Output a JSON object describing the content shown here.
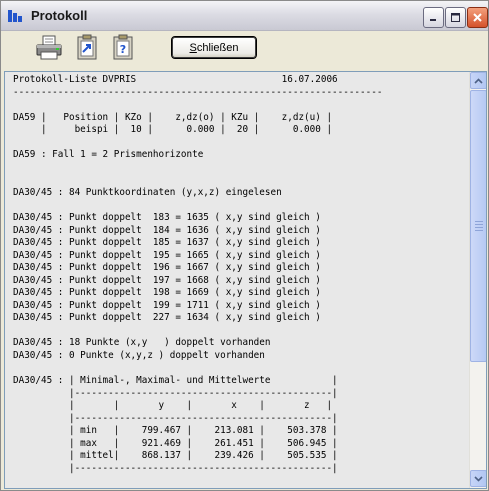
{
  "window": {
    "title": "Protokoll"
  },
  "toolbar": {
    "close_label_underlined": "S",
    "close_label_rest": "chließen",
    "icons": [
      "printer-icon",
      "clipboard-export-icon",
      "help-document-icon"
    ]
  },
  "protocol": {
    "lines": [
      "Protokoll-Liste DVPRIS                          16.07.2006",
      "------------------------------------------------------------------",
      "",
      "DA59 |   Position | KZo |    z,dz(o) | KZu |    z,dz(u) |",
      "     |     beispi |  10 |      0.000 |  20 |      0.000 |",
      "",
      "DA59 : Fall 1 = 2 Prismenhorizonte",
      "",
      "",
      "DA30/45 : 84 Punktkoordinaten (y,x,z) eingelesen",
      "",
      "DA30/45 : Punkt doppelt  183 = 1635 ( x,y sind gleich )",
      "DA30/45 : Punkt doppelt  184 = 1636 ( x,y sind gleich )",
      "DA30/45 : Punkt doppelt  185 = 1637 ( x,y sind gleich )",
      "DA30/45 : Punkt doppelt  195 = 1665 ( x,y sind gleich )",
      "DA30/45 : Punkt doppelt  196 = 1667 ( x,y sind gleich )",
      "DA30/45 : Punkt doppelt  197 = 1668 ( x,y sind gleich )",
      "DA30/45 : Punkt doppelt  198 = 1669 ( x,y sind gleich )",
      "DA30/45 : Punkt doppelt  199 = 1711 ( x,y sind gleich )",
      "DA30/45 : Punkt doppelt  227 = 1634 ( x,y sind gleich )",
      "",
      "DA30/45 : 18 Punkte (x,y   ) doppelt vorhanden",
      "DA30/45 : 0 Punkte (x,y,z ) doppelt vorhanden",
      "",
      "DA30/45 : | Minimal-, Maximal- und Mittelwerte           |",
      "          |----------------------------------------------|",
      "          |       |       y    |       x    |       z   |",
      "          |----------------------------------------------|",
      "          | min   |    799.467 |    213.081 |    503.378 |",
      "          | max   |    921.469 |    261.451 |    506.945 |",
      "          | mittel|    868.137 |    239.426 |    505.535 |",
      "          |----------------------------------------------|"
    ]
  },
  "colors": {
    "window_bg": "#ece9d8",
    "text_bg": "#e8e8e8",
    "scrollbar_accent": "#b6c9f3"
  }
}
